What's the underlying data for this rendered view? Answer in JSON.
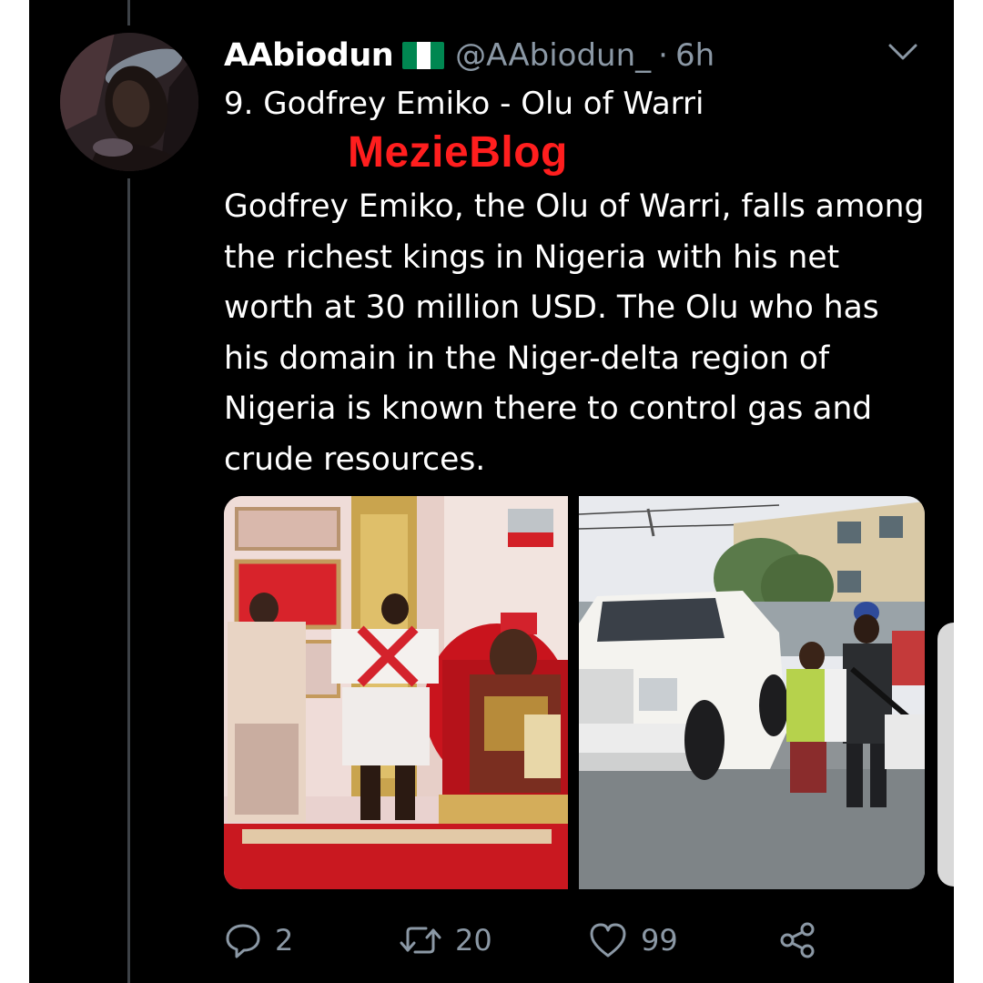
{
  "tweet": {
    "display_name": "AAbiodun",
    "handle": "@AAbiodun_",
    "separator": "·",
    "time": "6h",
    "heading": "9. Godfrey Emiko - Olu of Warri",
    "body": "Godfrey Emiko, the Olu of Warri, falls among the richest kings in Nigeria with his net worth at 30 million USD. The Olu who has his domain in the Niger-delta region of Nigeria is known there to control gas and crude resources.",
    "flag_colors": [
      "#008751",
      "#ffffff",
      "#008751"
    ]
  },
  "watermark": "MezieBlog",
  "actions": {
    "reply_count": "2",
    "retweet_count": "20",
    "like_count": "99"
  },
  "icons": {
    "menu": "chevron-down-icon",
    "reply": "speech-bubble-icon",
    "retweet": "retweet-arrows-icon",
    "like": "heart-icon",
    "share": "share-nodes-icon"
  },
  "colors": {
    "background": "#000000",
    "text": "#ffffff",
    "secondary_text": "#8b98a5",
    "watermark": "#ff1e1e",
    "thread_line": "#3d4247"
  }
}
